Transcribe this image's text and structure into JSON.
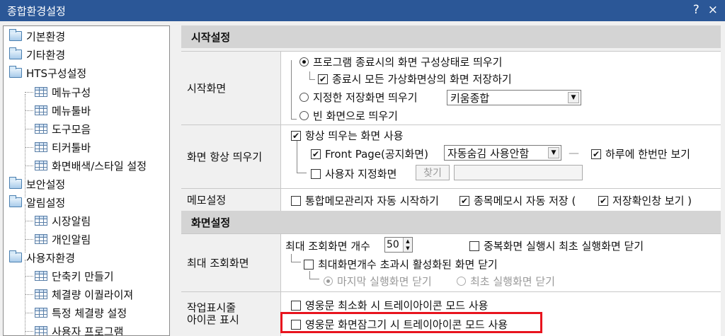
{
  "window": {
    "title": "종합환경설정",
    "help": "?",
    "close": "×"
  },
  "tree": [
    {
      "label": "기본환경"
    },
    {
      "label": "기타환경"
    },
    {
      "label": "HTS구성설정"
    },
    {
      "label": "메뉴구성"
    },
    {
      "label": "메뉴툴바"
    },
    {
      "label": "도구모음"
    },
    {
      "label": "티커툴바"
    },
    {
      "label": "화면배색/스타일 설정"
    },
    {
      "label": "보안설정"
    },
    {
      "label": "알림설정"
    },
    {
      "label": "시장알림"
    },
    {
      "label": "개인알림"
    },
    {
      "label": "사용자환경"
    },
    {
      "label": "단축키 만들기"
    },
    {
      "label": "체결량 이퀄라이져"
    },
    {
      "label": "특정 체결량 설정"
    },
    {
      "label": "사용자 프로그램"
    }
  ],
  "start": {
    "header": "시작설정",
    "screen_label": "시작화면",
    "opt1": "프로그램 종료시의 화면 구성상태로 띄우기",
    "opt1_sub": "종료시 모든 가상화면상의 화면 저장하기",
    "opt2": "지정한 저장화면 띄우기",
    "opt2_value": "키움종합",
    "opt3": "빈 화면으로 띄우기",
    "always_label": "화면 항상 띄우기",
    "always_use": "항상 띄우는 화면 사용",
    "front_page": "Front Page(공지화면)",
    "front_value": "자동숨김 사용안함",
    "dash": "—",
    "daily_once": "하루에 한번만 보기",
    "user_screen": "사용자 지정화면",
    "find": "찾기",
    "memo_label": "메모설정",
    "memo_auto": "통합메모관리자 자동 시작하기",
    "stock_memo": "종목메모시 자동 저장 (",
    "save_confirm": "저장확인창 보기 )"
  },
  "screen": {
    "header": "화면설정",
    "max_label": "최대 조회화면",
    "max_count": "최대 조회화면 개수",
    "max_value": "50",
    "dup_close": "중복화면 실행시 최초 실행화면 닫기",
    "exceed": "최대화면개수 초과시 활성화된 화면 닫기",
    "last_close": "마지막 실행화면 닫기",
    "first_close": "최초 실행화면 닫기",
    "tray_label_1": "작업표시줄",
    "tray_label_2": "아이콘 표시",
    "tray1": "영웅문 최소화 시 트레이아이콘 모드 사용",
    "tray2": "영웅문 화면잠그기 시 트레이아이콘 모드 사용"
  },
  "colors": {
    "title_bg": "#2b5797",
    "highlight": "#e8141e",
    "section_bg": "#d4d4d4"
  }
}
